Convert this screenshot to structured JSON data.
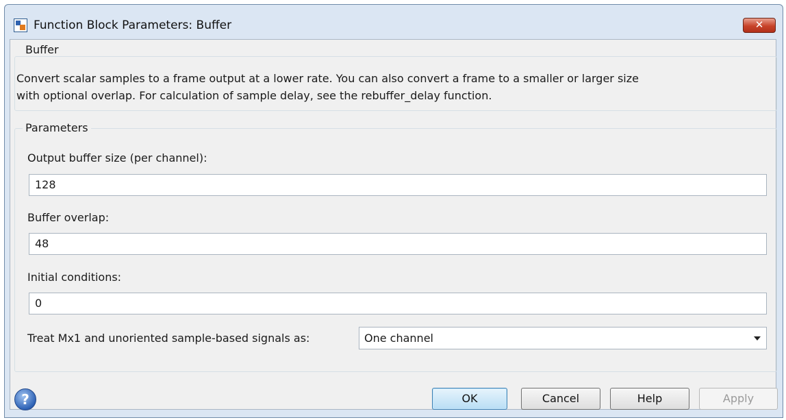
{
  "window": {
    "title": "Function Block Parameters: Buffer",
    "close_label": "✕"
  },
  "buffer_group": {
    "title": "Buffer",
    "description_line1": "Convert scalar samples to a frame output at a lower rate. You can also convert a frame to a smaller or larger size",
    "description_line2": "with optional overlap. For calculation of sample delay, see the rebuffer_delay function."
  },
  "parameters": {
    "title": "Parameters",
    "output_buffer_size": {
      "label": "Output buffer size (per channel):",
      "value": "128"
    },
    "buffer_overlap": {
      "label": "Buffer overlap:",
      "value": "48"
    },
    "initial_conditions": {
      "label": "Initial conditions:",
      "value": "0"
    },
    "treat_signals": {
      "label": "Treat Mx1 and unoriented sample-based signals as:",
      "value": "One channel"
    }
  },
  "footer": {
    "help_icon_glyph": "?",
    "ok_label": "OK",
    "cancel_label": "Cancel",
    "help_label": "Help",
    "apply_label": "Apply"
  },
  "colors": {
    "frame": "#dbe6f3",
    "close_button": "#c7432a",
    "ok_button": "#b9def5"
  },
  "icons": {
    "app": "simulink-block-icon",
    "help": "help-question-icon"
  }
}
